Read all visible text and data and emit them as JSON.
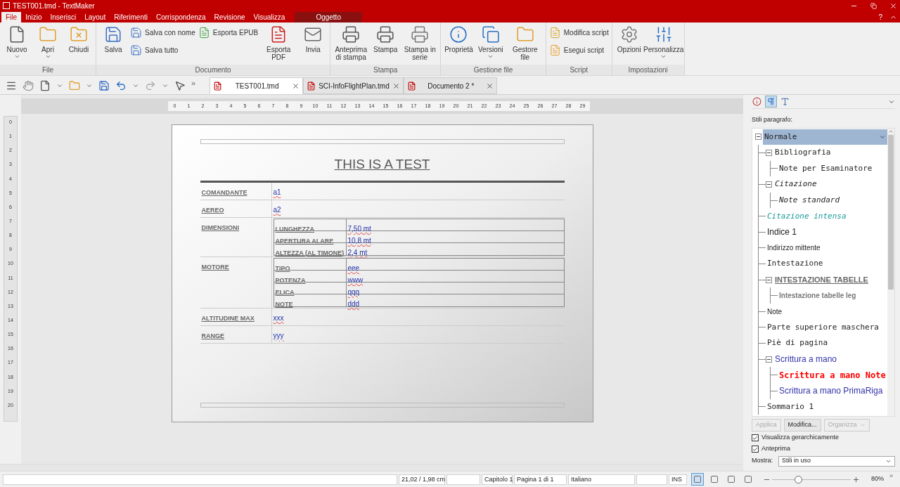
{
  "window": {
    "title": "TEST001.tmd - TextMaker"
  },
  "menu_tabs": [
    {
      "label": "File",
      "selected": true,
      "kind": "main"
    },
    {
      "label": "Inizio",
      "selected": false,
      "kind": "main"
    },
    {
      "label": "Inserisci",
      "selected": false,
      "kind": "main"
    },
    {
      "label": "Layout",
      "selected": false,
      "kind": "main"
    },
    {
      "label": "Riferimenti",
      "selected": false,
      "kind": "main"
    },
    {
      "label": "Corrispondenza",
      "selected": false,
      "kind": "main"
    },
    {
      "label": "Revisione",
      "selected": false,
      "kind": "main"
    },
    {
      "label": "Visualizza",
      "selected": false,
      "kind": "main"
    },
    {
      "label": "Oggetto",
      "selected": false,
      "kind": "context"
    }
  ],
  "help": "?",
  "ribbon": [
    {
      "label": "File",
      "columns": [
        {
          "kind": "large",
          "buttons": [
            {
              "label": "Nuovo",
              "dropdown": true
            }
          ]
        },
        {
          "kind": "large",
          "buttons": [
            {
              "label": "Apri",
              "dropdown": true
            }
          ]
        },
        {
          "kind": "large",
          "buttons": [
            {
              "label": "Chiudi",
              "dropdown": false
            }
          ]
        }
      ]
    },
    {
      "label": "Documento",
      "columns": [
        {
          "kind": "large",
          "buttons": [
            {
              "label": "Salva",
              "dropdown": false
            }
          ]
        },
        {
          "kind": "stack",
          "buttons": [
            {
              "label": "Salva con nome",
              "dropdown": false
            },
            {
              "label": "Salva tutto",
              "dropdown": false
            }
          ]
        },
        {
          "kind": "stack",
          "buttons": [
            {
              "label": "Esporta EPUB",
              "dropdown": false
            }
          ]
        },
        {
          "kind": "large",
          "buttons": [
            {
              "label": "Esporta PDF",
              "dropdown": false
            }
          ]
        },
        {
          "kind": "large",
          "buttons": [
            {
              "label": "Invia",
              "dropdown": false
            }
          ]
        }
      ]
    },
    {
      "label": "Stampa",
      "columns": [
        {
          "kind": "large",
          "buttons": [
            {
              "label": "Anteprima di stampa",
              "dropdown": false
            }
          ]
        },
        {
          "kind": "large",
          "buttons": [
            {
              "label": "Stampa",
              "dropdown": false
            }
          ]
        },
        {
          "kind": "large",
          "buttons": [
            {
              "label": "Stampa in serie",
              "dropdown": false
            }
          ]
        }
      ]
    },
    {
      "label": "Gestione file",
      "columns": [
        {
          "kind": "large",
          "buttons": [
            {
              "label": "Proprietà",
              "dropdown": false
            }
          ]
        },
        {
          "kind": "large",
          "buttons": [
            {
              "label": "Versioni",
              "dropdown": true
            }
          ]
        },
        {
          "kind": "large",
          "buttons": [
            {
              "label": "Gestore file",
              "dropdown": false
            }
          ]
        }
      ]
    },
    {
      "label": "Script",
      "columns": [
        {
          "kind": "stack",
          "buttons": [
            {
              "label": "Modifica script",
              "dropdown": false
            },
            {
              "label": "Esegui script",
              "dropdown": false
            }
          ]
        }
      ]
    },
    {
      "label": "Impostazioni",
      "columns": [
        {
          "kind": "large",
          "buttons": [
            {
              "label": "Opzioni",
              "dropdown": false
            }
          ]
        },
        {
          "kind": "large",
          "buttons": [
            {
              "label": "Personalizza",
              "dropdown": true
            }
          ]
        }
      ]
    }
  ],
  "toolbar_more": "»",
  "doc_tabs": [
    {
      "label": "TEST001.tmd",
      "selected": true
    },
    {
      "label": "SCI-InfoFlightPlan.tmd",
      "selected": false
    },
    {
      "label": "Documento 2 *",
      "selected": false
    }
  ],
  "ruler_h": [
    "0",
    "1",
    "2",
    "3",
    "4",
    "5",
    "6",
    "7",
    "8",
    "9",
    "10",
    "11",
    "12",
    "13",
    "14",
    "15",
    "16",
    "17",
    "18",
    "19",
    "20",
    "21",
    "22",
    "23",
    "24",
    "25",
    "26",
    "27",
    "28",
    "29"
  ],
  "ruler_v": [
    "0",
    "1",
    "2",
    "3",
    "4",
    "5",
    "6",
    "7",
    "8",
    "9",
    "10",
    "11",
    "12",
    "13",
    "14",
    "15",
    "16",
    "17",
    "18",
    "19",
    "20"
  ],
  "document": {
    "title": "THIS IS A TEST",
    "rows": [
      {
        "label": "COMANDANTE",
        "value": "a1"
      },
      {
        "label": "AEREO",
        "value": "a2"
      },
      {
        "label": "DIMENSIONI",
        "subrows": [
          {
            "label": "LUNGHEZZA",
            "value": "7,50 mt"
          },
          {
            "label": "APERTURA ALARE",
            "value": "10,8 mt"
          },
          {
            "label": "ALTEZZA (AL TIMONE)",
            "value": "2,4 mt"
          }
        ]
      },
      {
        "label": "MOTORE",
        "subrows": [
          {
            "label": "TIPO",
            "value": "eee"
          },
          {
            "label": "POTENZA",
            "value": "www"
          },
          {
            "label": "ELICA",
            "value": "qqq"
          },
          {
            "label": "NOTE",
            "value": "ddd"
          }
        ]
      },
      {
        "label": "ALTITUDINE MAX",
        "value": "xxx"
      },
      {
        "label": "RANGE",
        "value": "yyy"
      }
    ]
  },
  "panel": {
    "tabs": [
      {
        "selected": false
      },
      {
        "selected": true
      },
      {
        "selected": false
      }
    ],
    "heading": "Stili paragrafo:",
    "styles": [
      {
        "label": "Normale",
        "kind": "mono",
        "selected": true,
        "expanded": true,
        "children": [
          {
            "label": "Bibliografia",
            "kind": "mono",
            "selected": false,
            "expanded": true,
            "children": [
              {
                "label": "Note per Esaminatore",
                "kind": "mono",
                "selected": false
              }
            ]
          },
          {
            "label": "Citazione",
            "kind": "mono-italic",
            "selected": false,
            "expanded": true,
            "children": [
              {
                "label": "Note standard",
                "kind": "mono-italic",
                "selected": false
              }
            ]
          },
          {
            "label": "Citazione intensa",
            "kind": "accent-italic",
            "selected": false
          },
          {
            "label": "Indice 1",
            "kind": "sans-large",
            "selected": false
          },
          {
            "label": "Indirizzo mittente",
            "kind": "sans-small",
            "selected": false
          },
          {
            "label": "Intestazione",
            "kind": "mono",
            "selected": false
          },
          {
            "label": "INTESTAZIONE TABELLE",
            "kind": "heading",
            "selected": false,
            "expanded": true,
            "children": [
              {
                "label": "Intestazione tabelle leg",
                "kind": "subheading",
                "selected": false
              }
            ]
          },
          {
            "label": "Note",
            "kind": "sans-small",
            "selected": false
          },
          {
            "label": "Parte superiore maschera",
            "kind": "mono",
            "selected": false
          },
          {
            "label": "Piè di pagina",
            "kind": "mono",
            "selected": false
          },
          {
            "label": "Scrittura a mano",
            "kind": "hand",
            "selected": false,
            "expanded": true,
            "children": [
              {
                "label": "Scrittura a mano Note",
                "kind": "hand-note",
                "selected": false
              },
              {
                "label": "Scrittura a mano PrimaRiga",
                "kind": "hand",
                "selected": false
              }
            ]
          },
          {
            "label": "Sommario 1",
            "kind": "mono",
            "selected": false
          }
        ]
      }
    ],
    "buttons": [
      {
        "label": "Applica",
        "disabled": true,
        "dropdown": false
      },
      {
        "label": "Modifica...",
        "disabled": false,
        "dropdown": false
      },
      {
        "label": "Organizza",
        "disabled": true,
        "dropdown": true
      }
    ],
    "checkboxes": [
      {
        "label": "Visualizza gerarchicamente",
        "checked": true
      },
      {
        "label": "Anteprima",
        "checked": true
      }
    ],
    "show": {
      "label": "Mostra:",
      "value": "Stili in uso"
    }
  },
  "status_bar": {
    "fields": [
      {
        "kind": "blank"
      },
      {
        "kind": "text",
        "text": "21,02 / 1,98 cm"
      },
      {
        "kind": "blank"
      },
      {
        "kind": "text",
        "text": "Capitolo 1"
      },
      {
        "kind": "text",
        "text": "Pagina 1 di 1"
      },
      {
        "kind": "text",
        "text": "Italiano"
      },
      {
        "kind": "blank"
      },
      {
        "kind": "text",
        "text": "INS"
      }
    ],
    "view_modes": [
      {
        "selected": true
      },
      {
        "selected": false
      },
      {
        "selected": false
      },
      {
        "selected": false
      }
    ],
    "zoom": {
      "level": 0.33,
      "reading": "80%",
      "more": "»"
    }
  }
}
